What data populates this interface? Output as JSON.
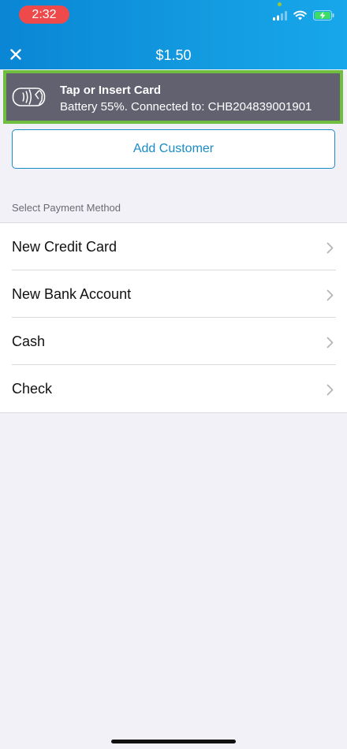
{
  "status_bar": {
    "time": "2:32",
    "icons": [
      "signal-icon",
      "wifi-icon",
      "battery-charging-icon"
    ],
    "battery_color": "#3ddc67"
  },
  "header": {
    "close_icon": "close-icon",
    "amount": "$1.50"
  },
  "reader": {
    "icon": "contactless-card-icon",
    "title": "Tap or Insert Card",
    "subtitle": "Battery 55%. Connected to: CHB204839001901",
    "highlight_color": "#6fbe3f"
  },
  "add_customer": {
    "label": "Add Customer"
  },
  "payment": {
    "section_label": "Select Payment Method",
    "methods": [
      {
        "label": "New Credit Card"
      },
      {
        "label": "New Bank Account"
      },
      {
        "label": "Cash"
      },
      {
        "label": "Check"
      }
    ]
  },
  "colors": {
    "accent": "#1a8bc6",
    "header_start": "#0a86d4",
    "header_end": "#17a7ea",
    "page_bg": "#f2f1f8"
  }
}
